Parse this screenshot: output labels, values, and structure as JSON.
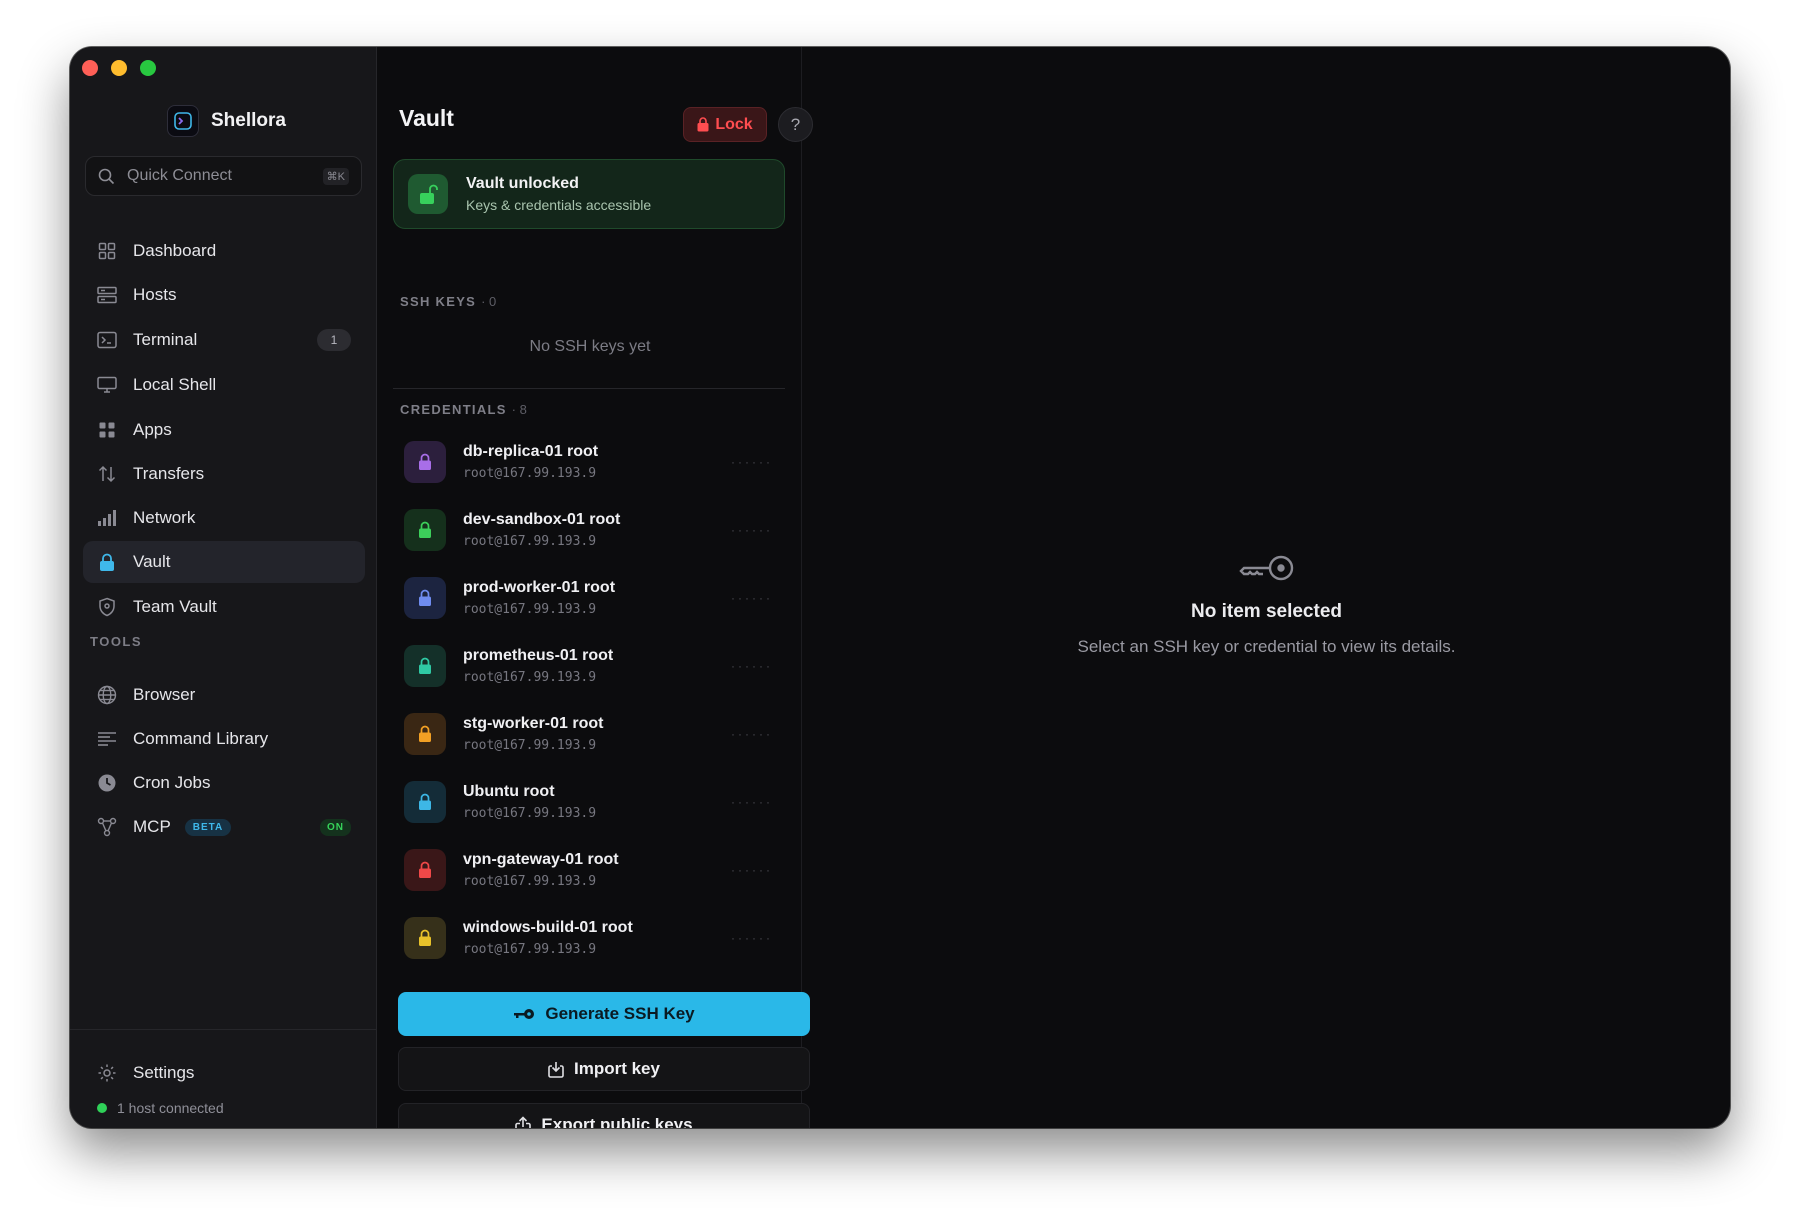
{
  "app": {
    "name": "Shellora"
  },
  "sidebar": {
    "quick_connect_placeholder": "Quick Connect",
    "quick_connect_shortcut": "⌘K",
    "items": [
      {
        "label": "Dashboard"
      },
      {
        "label": "Hosts"
      },
      {
        "label": "Terminal",
        "badge": "1"
      },
      {
        "label": "Local Shell"
      },
      {
        "label": "Apps"
      },
      {
        "label": "Transfers"
      },
      {
        "label": "Network"
      },
      {
        "label": "Vault",
        "active": true
      },
      {
        "label": "Team Vault"
      }
    ],
    "tools_label": "TOOLS",
    "tools": [
      {
        "label": "Browser"
      },
      {
        "label": "Command Library"
      },
      {
        "label": "Cron Jobs"
      },
      {
        "label": "MCP",
        "beta": "BETA",
        "status": "ON"
      }
    ],
    "settings_label": "Settings",
    "status_text": "1 host connected"
  },
  "vault": {
    "title": "Vault",
    "lock_label": "Lock",
    "help_label": "?",
    "unlocked_title": "Vault unlocked",
    "unlocked_subtitle": "Keys & credentials accessible",
    "ssh_keys_label": "SSH KEYS",
    "ssh_keys_count": "· 0",
    "no_keys_text": "No SSH keys yet",
    "credentials_label": "CREDENTIALS",
    "credentials_count": "· 8",
    "credentials": [
      {
        "name": "db-replica-01 root",
        "sub": "root@167.99.193.9",
        "mask": "······",
        "color": "#a86ee8",
        "bg": "#2c1f3d"
      },
      {
        "name": "dev-sandbox-01 root",
        "sub": "root@167.99.193.9",
        "mask": "······",
        "color": "#3ccf5a",
        "bg": "#15301c"
      },
      {
        "name": "prod-worker-01 root",
        "sub": "root@167.99.193.9",
        "mask": "······",
        "color": "#6f8cf0",
        "bg": "#1c2440"
      },
      {
        "name": "prometheus-01 root",
        "sub": "root@167.99.193.9",
        "mask": "······",
        "color": "#2fc9a4",
        "bg": "#143029"
      },
      {
        "name": "stg-worker-01 root",
        "sub": "root@167.99.193.9",
        "mask": "······",
        "color": "#f2a024",
        "bg": "#3a2714"
      },
      {
        "name": "Ubuntu root",
        "sub": "root@167.99.193.9",
        "mask": "······",
        "color": "#3db7e6",
        "bg": "#142c38"
      },
      {
        "name": "vpn-gateway-01 root",
        "sub": "root@167.99.193.9",
        "mask": "······",
        "color": "#f04848",
        "bg": "#3a1718"
      },
      {
        "name": "windows-build-01 root",
        "sub": "root@167.99.193.9",
        "mask": "······",
        "color": "#e8c22a",
        "bg": "#36301a"
      }
    ],
    "generate_label": "Generate SSH Key",
    "import_label": "Import key",
    "export_label": "Export public keys"
  },
  "detail": {
    "empty_title": "No item selected",
    "empty_subtitle": "Select an SSH key or credential to view its details."
  },
  "colors": {
    "accent": "#2ab8e8",
    "danger": "#ff4d50",
    "success": "#2fd158"
  }
}
